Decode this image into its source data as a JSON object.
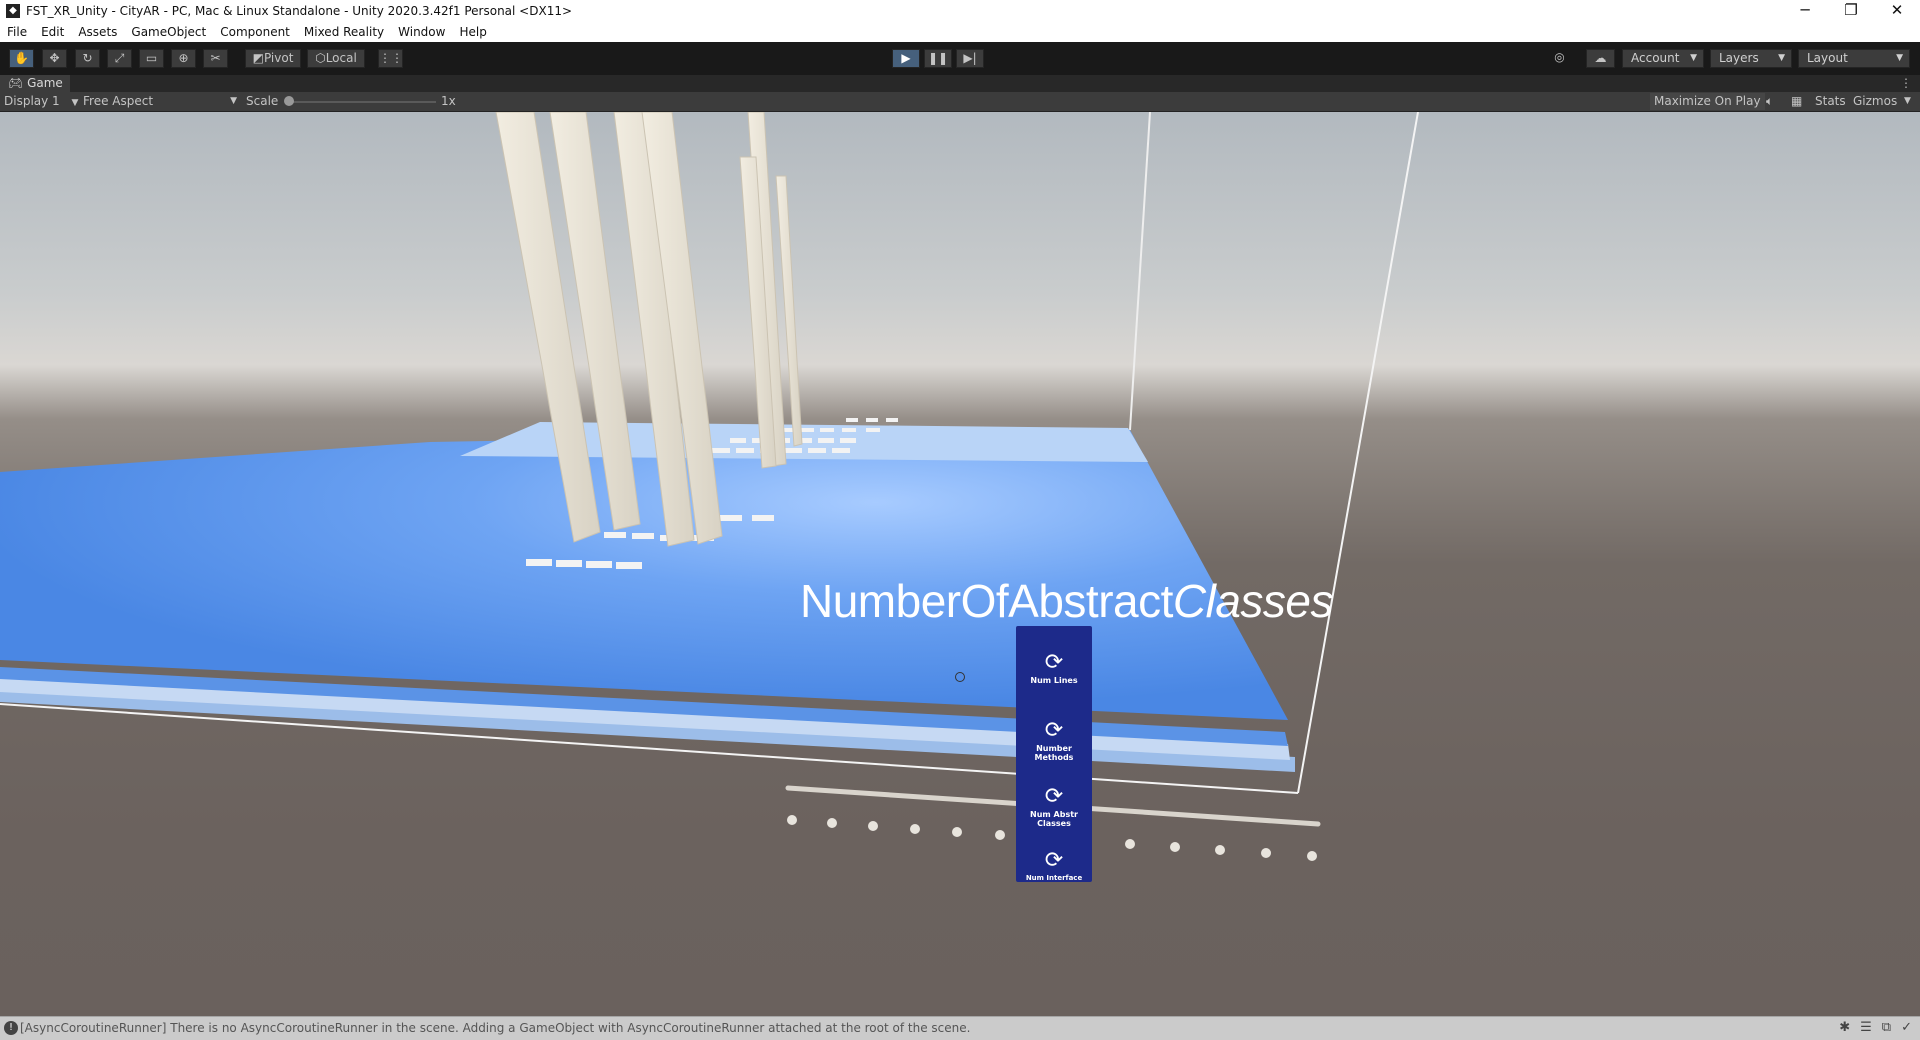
{
  "window": {
    "title": "FST_XR_Unity - CityAR - PC, Mac & Linux Standalone - Unity 2020.3.42f1 Personal <DX11>",
    "minimize": "─",
    "restore": "❐",
    "close": "✕"
  },
  "menu": [
    "File",
    "Edit",
    "Assets",
    "GameObject",
    "Component",
    "Mixed Reality",
    "Window",
    "Help"
  ],
  "toolbar": {
    "tools": [
      "hand-tool",
      "move-tool",
      "rotate-tool",
      "scale-tool",
      "rect-tool",
      "transform-tool",
      "custom-tool"
    ],
    "pivot_label": "Pivot",
    "local_label": "Local",
    "account_label": "Account",
    "layers_label": "Layers",
    "layout_label": "Layout"
  },
  "game_tab": {
    "label": "Game"
  },
  "game_bar": {
    "display": "Display 1",
    "aspect": "Free Aspect",
    "scale_label": "Scale",
    "scale_value": "1x",
    "maximize": "Maximize On Play",
    "stats": "Stats",
    "gizmos": "Gizmos"
  },
  "scene": {
    "metric_title_a": "NumberOfAbstract",
    "metric_title_b": "Classes",
    "panel_items": [
      "Num Lines",
      "Number Methods",
      "Num Abstr Classes",
      "Num Interface"
    ]
  },
  "status": {
    "message": "[AsyncCoroutineRunner] There is no AsyncCoroutineRunner in the scene. Adding a GameObject with AsyncCoroutineRunner attached at the root of the scene."
  }
}
